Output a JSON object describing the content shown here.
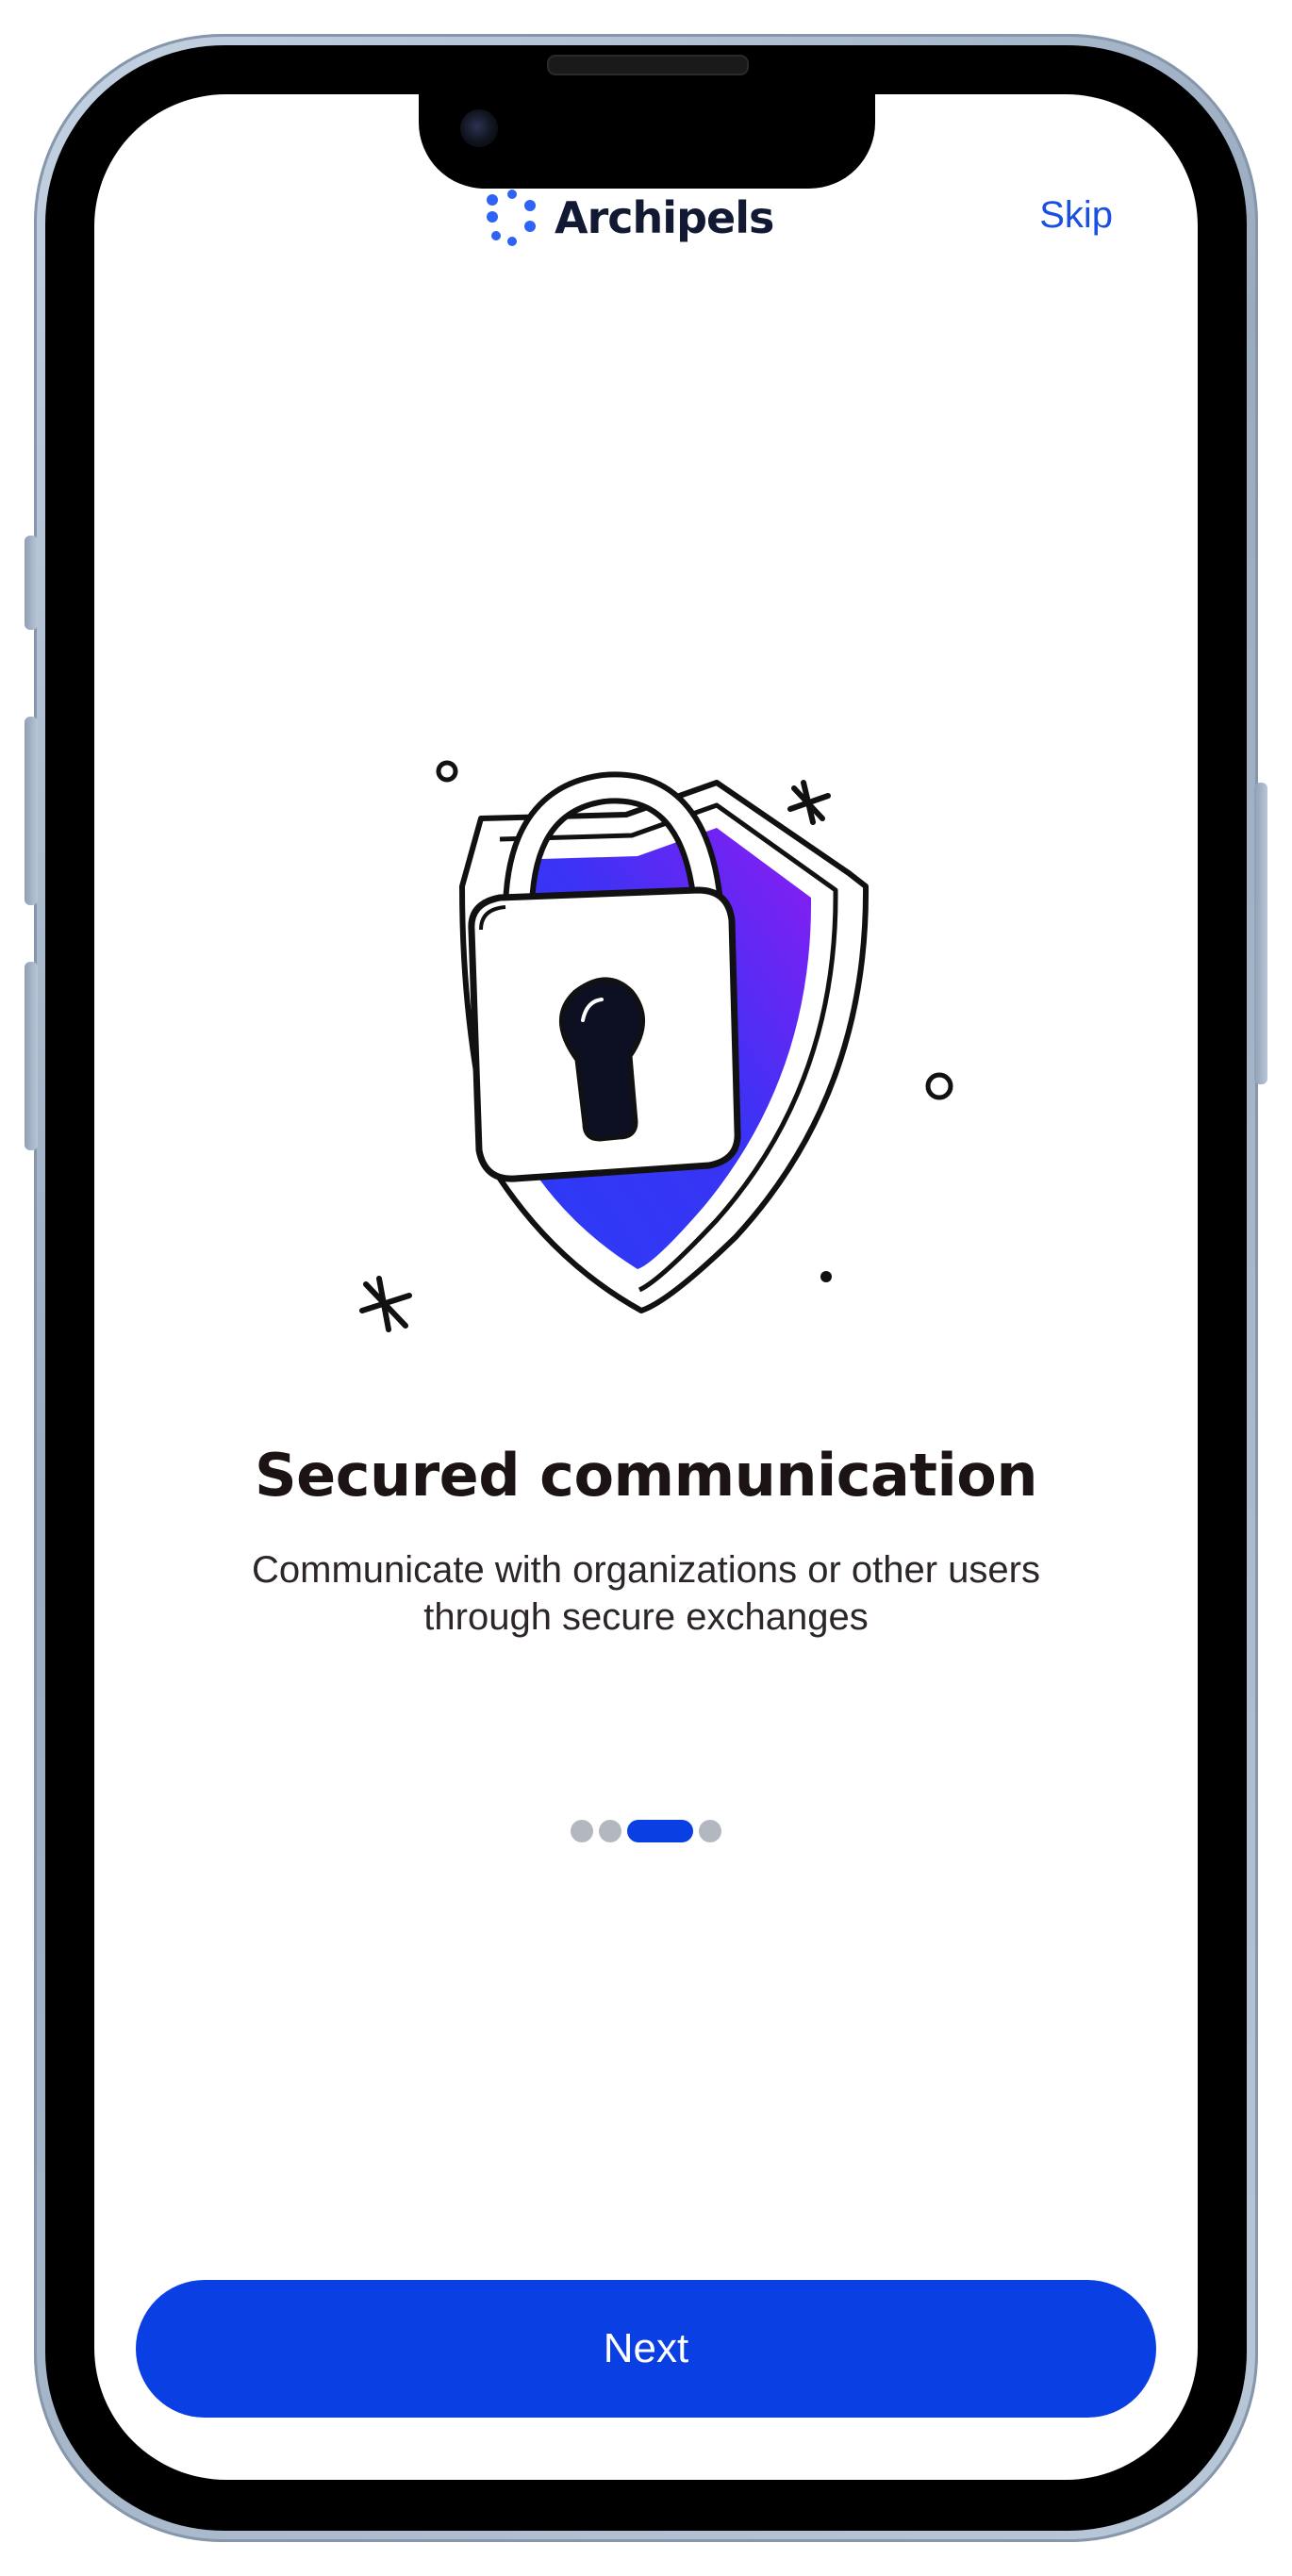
{
  "header": {
    "brand": "Archipels",
    "skip_label": "Skip"
  },
  "onboarding": {
    "illustration": "shield-lock-icon",
    "title": "Secured communication",
    "subtitle_line1": "Communicate with organizations or other users",
    "subtitle_line2": "through secure exchanges",
    "pagination": {
      "total": 4,
      "active_index": 2
    }
  },
  "footer": {
    "next_label": "Next"
  },
  "colors": {
    "accent": "#0a3fe3",
    "title": "#1c1414",
    "shield_blue": "#3b33f5",
    "shield_purple": "#8c1cf2",
    "dot_inactive": "#b3b7c0"
  }
}
